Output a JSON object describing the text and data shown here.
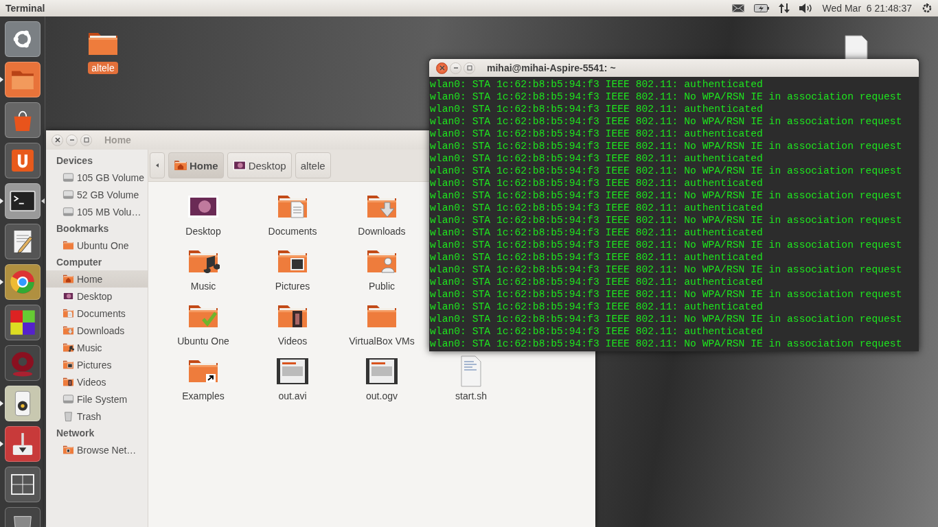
{
  "top_panel": {
    "app_title": "Terminal",
    "clock": "Wed Mar  6 21:48:37"
  },
  "launcher": {
    "items": [
      {
        "kind": "dash",
        "running": false,
        "focused": false
      },
      {
        "kind": "files",
        "running": true,
        "focused": false
      },
      {
        "kind": "shop",
        "running": false,
        "focused": false
      },
      {
        "kind": "cloud",
        "running": false,
        "focused": false
      },
      {
        "kind": "terminal",
        "running": true,
        "focused": true
      },
      {
        "kind": "editor",
        "running": false,
        "focused": false
      },
      {
        "kind": "browser",
        "running": true,
        "focused": false
      },
      {
        "kind": "cubes",
        "running": false,
        "focused": false
      },
      {
        "kind": "swirl",
        "running": false,
        "focused": false
      },
      {
        "kind": "speaker",
        "running": true,
        "focused": false
      },
      {
        "kind": "installer",
        "running": true,
        "focused": false
      },
      {
        "kind": "workspaces",
        "running": false,
        "focused": false
      },
      {
        "kind": "trash",
        "running": false,
        "focused": false
      }
    ]
  },
  "desktop_icons": [
    {
      "kind": "folder",
      "label": "altele",
      "selected": true
    }
  ],
  "files_window": {
    "title": "Home",
    "breadcrumbs": [
      {
        "label": "Home",
        "kind": "home",
        "selected": true
      },
      {
        "label": "Desktop",
        "kind": "desktop",
        "selected": false
      },
      {
        "label": "altele",
        "kind": "plain",
        "selected": false
      }
    ],
    "sidebar": [
      {
        "heading": "Devices",
        "items": [
          {
            "label": "105 GB Volume",
            "kind": "drive",
            "selected": false
          },
          {
            "label": "52 GB Volume",
            "kind": "drive",
            "selected": false
          },
          {
            "label": "105 MB Volu…",
            "kind": "drive",
            "selected": false
          }
        ]
      },
      {
        "heading": "Bookmarks",
        "items": [
          {
            "label": "Ubuntu One",
            "kind": "folder",
            "selected": false
          }
        ]
      },
      {
        "heading": "Computer",
        "items": [
          {
            "label": "Home",
            "kind": "home",
            "selected": true
          },
          {
            "label": "Desktop",
            "kind": "desktop",
            "selected": false
          },
          {
            "label": "Documents",
            "kind": "documents",
            "selected": false
          },
          {
            "label": "Downloads",
            "kind": "downloads",
            "selected": false
          },
          {
            "label": "Music",
            "kind": "music",
            "selected": false
          },
          {
            "label": "Pictures",
            "kind": "pictures",
            "selected": false
          },
          {
            "label": "Videos",
            "kind": "videos",
            "selected": false
          },
          {
            "label": "File System",
            "kind": "drive",
            "selected": false
          },
          {
            "label": "Trash",
            "kind": "trash",
            "selected": false
          }
        ]
      },
      {
        "heading": "Network",
        "items": [
          {
            "label": "Browse Net…",
            "kind": "network",
            "selected": false
          }
        ]
      }
    ],
    "rows": [
      [
        {
          "label": "Desktop",
          "kind": "desktop"
        },
        {
          "label": "Documents",
          "kind": "documents"
        },
        {
          "label": "Downloads",
          "kind": "downloads"
        }
      ],
      [
        {
          "label": "Music",
          "kind": "music"
        },
        {
          "label": "Pictures",
          "kind": "pictures"
        },
        {
          "label": "Public",
          "kind": "public"
        }
      ],
      [
        {
          "label": "Ubuntu One",
          "kind": "checked"
        },
        {
          "label": "Videos",
          "kind": "videos"
        },
        {
          "label": "VirtualBox VMs",
          "kind": "folder"
        }
      ],
      [
        {
          "label": "Examples",
          "kind": "link"
        },
        {
          "label": "out.avi",
          "kind": "video"
        },
        {
          "label": "out.ogv",
          "kind": "video"
        },
        {
          "label": "start.sh",
          "kind": "script"
        }
      ]
    ]
  },
  "terminal": {
    "title": "mihai@mihai-Aspire-5541: ~",
    "lines": [
      "wlan0: STA 1c:62:b8:b5:94:f3 IEEE 802.11: authenticated",
      "wlan0: STA 1c:62:b8:b5:94:f3 IEEE 802.11: No WPA/RSN IE in association request",
      "wlan0: STA 1c:62:b8:b5:94:f3 IEEE 802.11: authenticated",
      "wlan0: STA 1c:62:b8:b5:94:f3 IEEE 802.11: No WPA/RSN IE in association request",
      "wlan0: STA 1c:62:b8:b5:94:f3 IEEE 802.11: authenticated",
      "wlan0: STA 1c:62:b8:b5:94:f3 IEEE 802.11: No WPA/RSN IE in association request",
      "wlan0: STA 1c:62:b8:b5:94:f3 IEEE 802.11: authenticated",
      "wlan0: STA 1c:62:b8:b5:94:f3 IEEE 802.11: No WPA/RSN IE in association request",
      "wlan0: STA 1c:62:b8:b5:94:f3 IEEE 802.11: authenticated",
      "wlan0: STA 1c:62:b8:b5:94:f3 IEEE 802.11: No WPA/RSN IE in association request",
      "wlan0: STA 1c:62:b8:b5:94:f3 IEEE 802.11: authenticated",
      "wlan0: STA 1c:62:b8:b5:94:f3 IEEE 802.11: No WPA/RSN IE in association request",
      "wlan0: STA 1c:62:b8:b5:94:f3 IEEE 802.11: authenticated",
      "wlan0: STA 1c:62:b8:b5:94:f3 IEEE 802.11: No WPA/RSN IE in association request",
      "wlan0: STA 1c:62:b8:b5:94:f3 IEEE 802.11: authenticated",
      "wlan0: STA 1c:62:b8:b5:94:f3 IEEE 802.11: No WPA/RSN IE in association request",
      "wlan0: STA 1c:62:b8:b5:94:f3 IEEE 802.11: authenticated",
      "wlan0: STA 1c:62:b8:b5:94:f3 IEEE 802.11: No WPA/RSN IE in association request",
      "wlan0: STA 1c:62:b8:b5:94:f3 IEEE 802.11: authenticated",
      "wlan0: STA 1c:62:b8:b5:94:f3 IEEE 802.11: No WPA/RSN IE in association request",
      "wlan0: STA 1c:62:b8:b5:94:f3 IEEE 802.11: authenticated",
      "wlan0: STA 1c:62:b8:b5:94:f3 IEEE 802.11: No WPA/RSN IE in association request"
    ]
  }
}
